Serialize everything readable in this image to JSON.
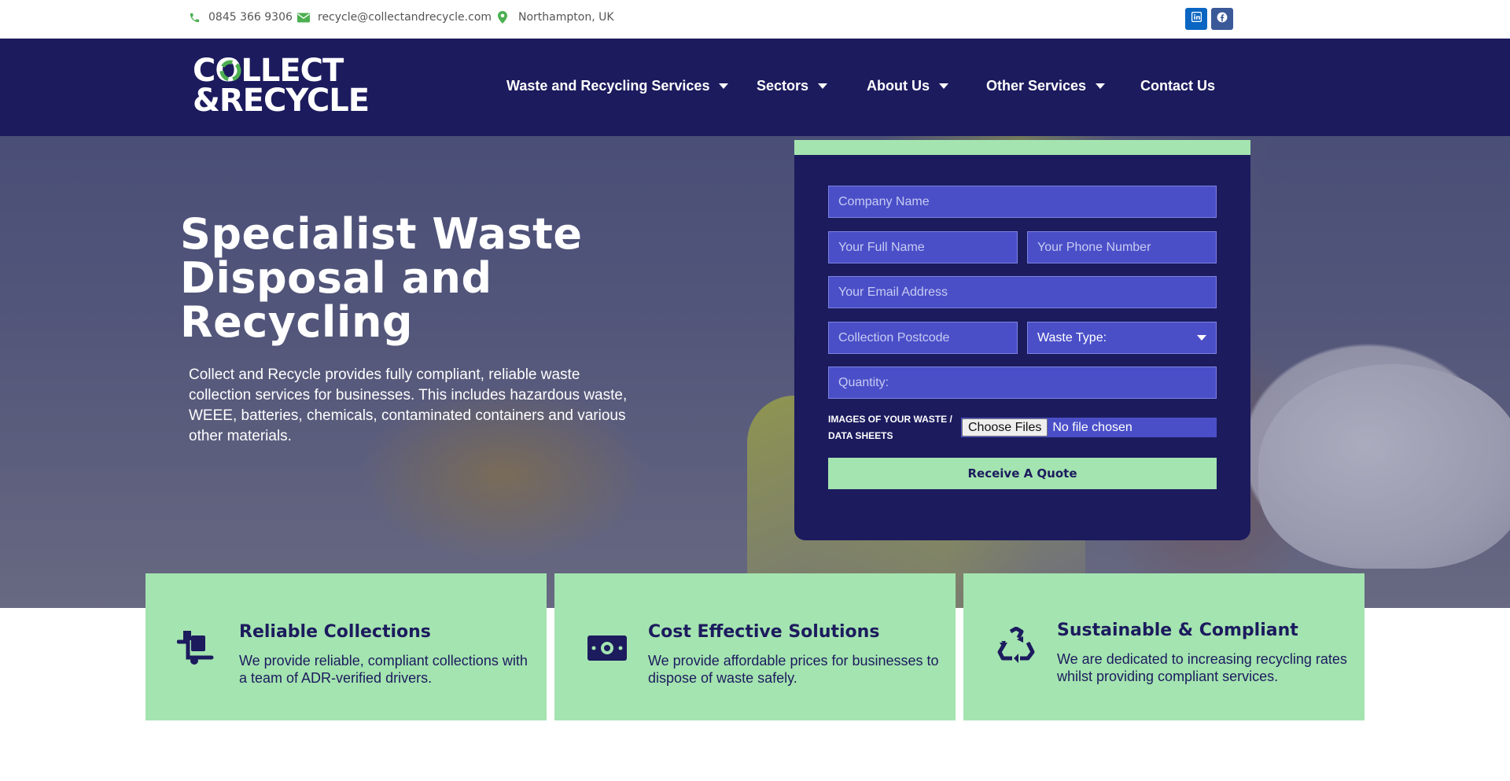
{
  "topbar": {
    "phone": "0845 366 9306",
    "email": "recycle@collectandrecycle.com",
    "location": "Northampton, UK",
    "phone_icon": "phone-icon",
    "email_icon": "envelope-icon",
    "location_icon": "map-marker-icon",
    "social": [
      "linkedin-icon",
      "facebook-icon"
    ]
  },
  "header": {
    "logo_line1": "COLLECT",
    "logo_line2": "&RECYCLE",
    "nav": [
      {
        "label": "Waste and Recycling Services",
        "has_dropdown": true
      },
      {
        "label": "Sectors",
        "has_dropdown": true
      },
      {
        "label": "About Us",
        "has_dropdown": true
      },
      {
        "label": "Other Services",
        "has_dropdown": true
      },
      {
        "label": "Contact Us",
        "has_dropdown": false
      }
    ]
  },
  "hero": {
    "title": "Specialist Waste Disposal and Recycling",
    "text": "Collect and Recycle provides fully compliant, reliable waste collection services for businesses. This includes hazardous waste, WEEE, batteries, chemicals, contaminated containers and various other materials."
  },
  "form": {
    "company_placeholder": "Company Name",
    "fullname_placeholder": "Your Full Name",
    "phone_placeholder": "Your Phone Number",
    "email_placeholder": "Your Email Address",
    "postcode_placeholder": "Collection Postcode",
    "waste_type_selected": "Waste Type:",
    "quantity_placeholder": "Quantity:",
    "file_label": "IMAGES OF YOUR WASTE / DATA SHEETS",
    "file_button": "Choose Files",
    "file_status": "No file chosen",
    "submit_label": "Receive A Quote"
  },
  "features": [
    {
      "icon": "delivery-truck-icon",
      "title": "Reliable Collections",
      "text": "We provide reliable, compliant collections with a team of ADR-verified drivers."
    },
    {
      "icon": "money-bill-icon",
      "title": "Cost Effective Solutions",
      "text": "We provide affordable prices for businesses to dispose of waste safely."
    },
    {
      "icon": "recycle-icon",
      "title": "Sustainable & Compliant",
      "text": "We are dedicated to increasing recycling rates whilst providing compliant services."
    }
  ],
  "colors": {
    "navy": "#1c1b5e",
    "mint": "#a4e4b0",
    "field_blue": "#4a4fc8",
    "accent_green": "#4caf50"
  }
}
